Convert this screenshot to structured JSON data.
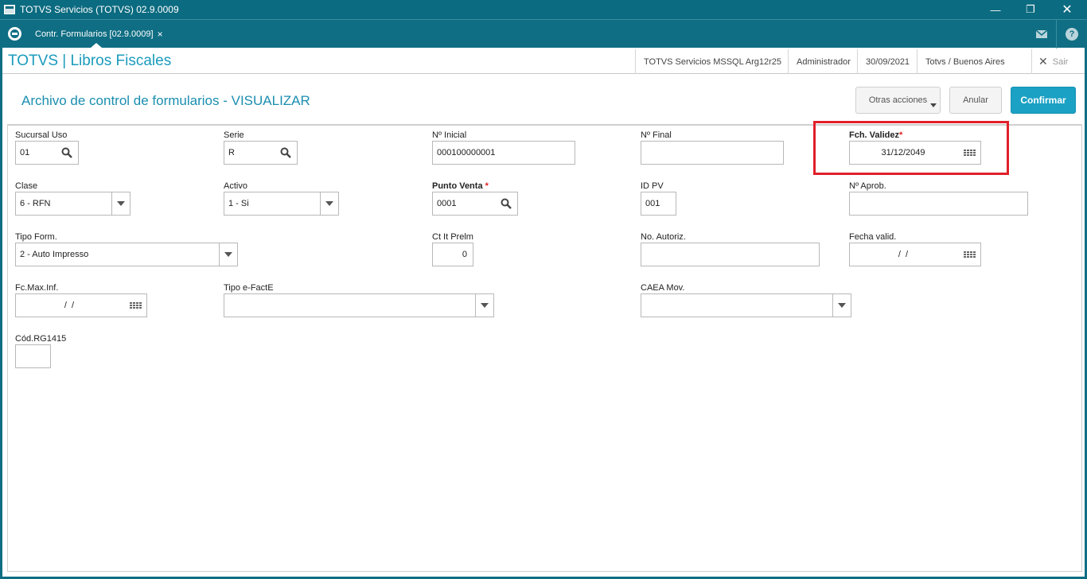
{
  "window": {
    "title": "TOTVS Servicios (TOTVS) 02.9.0009"
  },
  "tab": {
    "label": "Contr. Formularios [02.9.0009]",
    "close": "×"
  },
  "header": {
    "module": "TOTVS | Libros Fiscales",
    "environment": "TOTVS Servicios MSSQL Arg12r25",
    "user": "Administrador",
    "date": "30/09/2021",
    "company": "Totvs / Buenos Aires",
    "exit_label": "Sair"
  },
  "page": {
    "title": "Archivo de control de formularios - VISUALIZAR",
    "actions": {
      "more": "Otras acciones",
      "cancel": "Anular",
      "confirm": "Confirmar"
    }
  },
  "fields": {
    "sucursal_uso": {
      "label": "Sucursal Uso",
      "value": "01"
    },
    "serie": {
      "label": "Serie",
      "value": "R"
    },
    "nro_inicial": {
      "label": "Nº Inicial",
      "value": "000100000001"
    },
    "nro_final": {
      "label": "Nº Final",
      "value": ""
    },
    "fch_validez": {
      "label": "Fch. Validez",
      "required": "*",
      "value": "31/12/2049"
    },
    "clase": {
      "label": "Clase",
      "value": "6 - RFN"
    },
    "activo": {
      "label": "Activo",
      "value": "1 - Si"
    },
    "punto_venta": {
      "label": "Punto Venta",
      "required": "*",
      "value": "0001"
    },
    "id_pv": {
      "label": "ID PV",
      "value": "001"
    },
    "nro_aprob": {
      "label": "Nº Aprob.",
      "value": ""
    },
    "tipo_form": {
      "label": "Tipo Form.",
      "value": "2 - Auto Impresso"
    },
    "ct_it_prelm": {
      "label": "Ct It Prelm",
      "value": "0"
    },
    "no_autoriz": {
      "label": "No. Autoriz.",
      "value": ""
    },
    "fecha_valid": {
      "label": "Fecha valid.",
      "value": "/  /"
    },
    "fc_max_inf": {
      "label": "Fc.Max.Inf.",
      "value": "/  /"
    },
    "tipo_efacte": {
      "label": "Tipo e-FactE",
      "value": ""
    },
    "caea_mov": {
      "label": "CAEA Mov.",
      "value": ""
    },
    "cod_rg1415": {
      "label": "Cód.RG1415",
      "value": ""
    }
  },
  "icons": {
    "search": "search-icon",
    "calendar": "calendar-icon",
    "dropdown": "chevron-down-icon",
    "mail": "mail-icon",
    "help": "help-icon",
    "close": "close-icon"
  },
  "colors": {
    "accent": "#1ba1c4",
    "topbar": "#0f6e83",
    "highlight": "#e0202a",
    "title": "#1a9bbd"
  }
}
